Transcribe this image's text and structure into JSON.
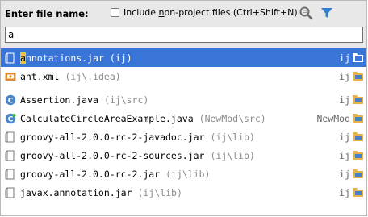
{
  "header": {
    "title": "Enter file name:",
    "checkbox_pre": "Include ",
    "checkbox_ul": "n",
    "checkbox_post": "on-project files (Ctrl+Shift+N)",
    "checkbox_checked": false
  },
  "search": {
    "value": "a"
  },
  "results": [
    {
      "hl": "a",
      "rest": "nnotations.jar",
      "path": "(ij)",
      "module": "ij",
      "icon": "jar-icon",
      "selected": true
    },
    {
      "hl": "",
      "rest": "ant.xml",
      "path": "(ij\\.idea)",
      "module": "ij",
      "icon": "xml-icon"
    },
    {
      "hl": "",
      "rest": "Assertion.java",
      "path": "(ij\\src)",
      "module": "ij",
      "icon": "java-class-icon"
    },
    {
      "hl": "",
      "rest": "CalculateCircleAreaExample.java",
      "path": "(NewMod\\src)",
      "module": "NewMod",
      "icon": "java-class-icon"
    },
    {
      "hl": "",
      "rest": "groovy-all-2.0.0-rc-2-javadoc.jar",
      "path": "(ij\\lib)",
      "module": "ij",
      "icon": "jar-icon"
    },
    {
      "hl": "",
      "rest": "groovy-all-2.0.0-rc-2-sources.jar",
      "path": "(ij\\lib)",
      "module": "ij",
      "icon": "jar-icon"
    },
    {
      "hl": "",
      "rest": "groovy-all-2.0.0-rc-2.jar",
      "path": "(ij\\lib)",
      "module": "ij",
      "icon": "jar-icon"
    },
    {
      "hl": "",
      "rest": "javax.annotation.jar",
      "path": "(ij\\lib)",
      "module": "ij",
      "icon": "jar-icon"
    }
  ],
  "colors": {
    "selection": "#3875d7",
    "match_highlight": "#e9c341",
    "filter_icon": "#2f7fd1"
  }
}
